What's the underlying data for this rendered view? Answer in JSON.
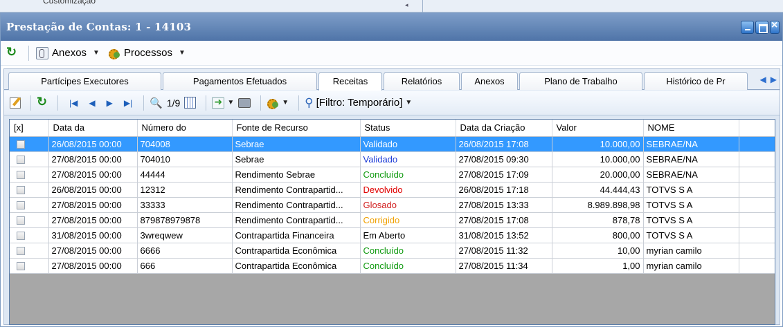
{
  "background": {
    "partial_label": "Customização"
  },
  "window": {
    "title": "Prestação de Contas: 1 - 14103"
  },
  "menubar": {
    "anexos": "Anexos",
    "processos": "Processos"
  },
  "tabs": [
    "Partícipes Executores",
    "Pagamentos Efetuados",
    "Receitas",
    "Relatórios",
    "Anexos",
    "Plano de Trabalho",
    "Histórico de Pr"
  ],
  "active_tab": "Receitas",
  "toolbar": {
    "page": "1/9",
    "filter": "[Filtro: Temporário]"
  },
  "grid": {
    "columns": [
      "[x]",
      "Data da",
      "Número do",
      "Fonte de Recurso",
      "Status",
      "Data da Criação",
      "Valor",
      "NOME"
    ],
    "rows": [
      {
        "data": "26/08/2015 00:00",
        "numero": "704008",
        "fonte": "Sebrae",
        "status": "Validado",
        "criacao": "26/08/2015 17:08",
        "valor": "10.000,00",
        "nome": "SEBRAE/NA"
      },
      {
        "data": "27/08/2015 00:00",
        "numero": "704010",
        "fonte": "Sebrae",
        "status": "Validado",
        "criacao": "27/08/2015 09:30",
        "valor": "10.000,00",
        "nome": "SEBRAE/NA"
      },
      {
        "data": "27/08/2015 00:00",
        "numero": "44444",
        "fonte": "Rendimento Sebrae",
        "status": "Concluído",
        "criacao": "27/08/2015 17:09",
        "valor": "20.000,00",
        "nome": "SEBRAE/NA"
      },
      {
        "data": "26/08/2015 00:00",
        "numero": "12312",
        "fonte": "Rendimento Contrapartid...",
        "status": "Devolvido",
        "criacao": "26/08/2015 17:18",
        "valor": "44.444,43",
        "nome": "TOTVS S A"
      },
      {
        "data": "27/08/2015 00:00",
        "numero": "33333",
        "fonte": "Rendimento Contrapartid...",
        "status": "Glosado",
        "criacao": "27/08/2015 13:33",
        "valor": "8.989.898,98",
        "nome": "TOTVS S A"
      },
      {
        "data": "27/08/2015 00:00",
        "numero": "879878979878",
        "fonte": "Rendimento Contrapartid...",
        "status": "Corrigido",
        "criacao": "27/08/2015 17:08",
        "valor": "878,78",
        "nome": "TOTVS S A"
      },
      {
        "data": "31/08/2015 00:00",
        "numero": "3wreqwew",
        "fonte": "Contrapartida Financeira",
        "status": "Em Aberto",
        "criacao": "31/08/2015 13:52",
        "valor": "800,00",
        "nome": "TOTVS S A"
      },
      {
        "data": "27/08/2015 00:00",
        "numero": "6666",
        "fonte": "Contrapartida Econômica",
        "status": "Concluído",
        "criacao": "27/08/2015 11:32",
        "valor": "10,00",
        "nome": "myrian camilo"
      },
      {
        "data": "27/08/2015 00:00",
        "numero": "666",
        "fonte": "Contrapartida Econômica",
        "status": "Concluído",
        "criacao": "27/08/2015 11:34",
        "valor": "1,00",
        "nome": "myrian camilo"
      }
    ]
  },
  "status_colors": {
    "Validado": "#1d3bd6",
    "Concluído": "#0f9a0f",
    "Devolvido": "#e00000",
    "Glosado": "#d21f1f",
    "Corrigido": "#f0a000",
    "Em Aberto": "#000000"
  },
  "selected_row_color": "#3399ff"
}
